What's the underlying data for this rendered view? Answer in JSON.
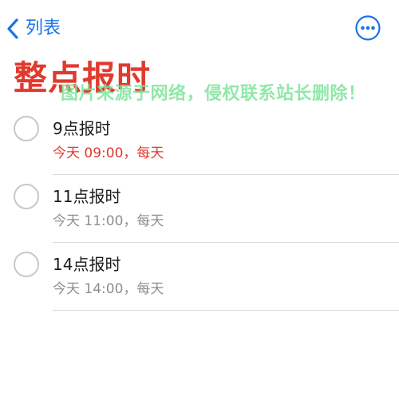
{
  "nav": {
    "back_label": "列表",
    "accent_color": "#1a73e8",
    "back_icon": "chevron-left-icon",
    "more_icon": "ellipsis-circle-icon"
  },
  "page": {
    "title": "整点报时",
    "title_color": "#e03a2f"
  },
  "watermark": {
    "text": "图片来源于网络，侵权联系站长删除！"
  },
  "reminders": [
    {
      "title": "9点报时",
      "subtitle": "今天 09:00，每天",
      "overdue": true
    },
    {
      "title": "11点报时",
      "subtitle": "今天 11:00，每天",
      "overdue": false
    },
    {
      "title": "14点报时",
      "subtitle": "今天 14:00，每天",
      "overdue": false
    }
  ]
}
